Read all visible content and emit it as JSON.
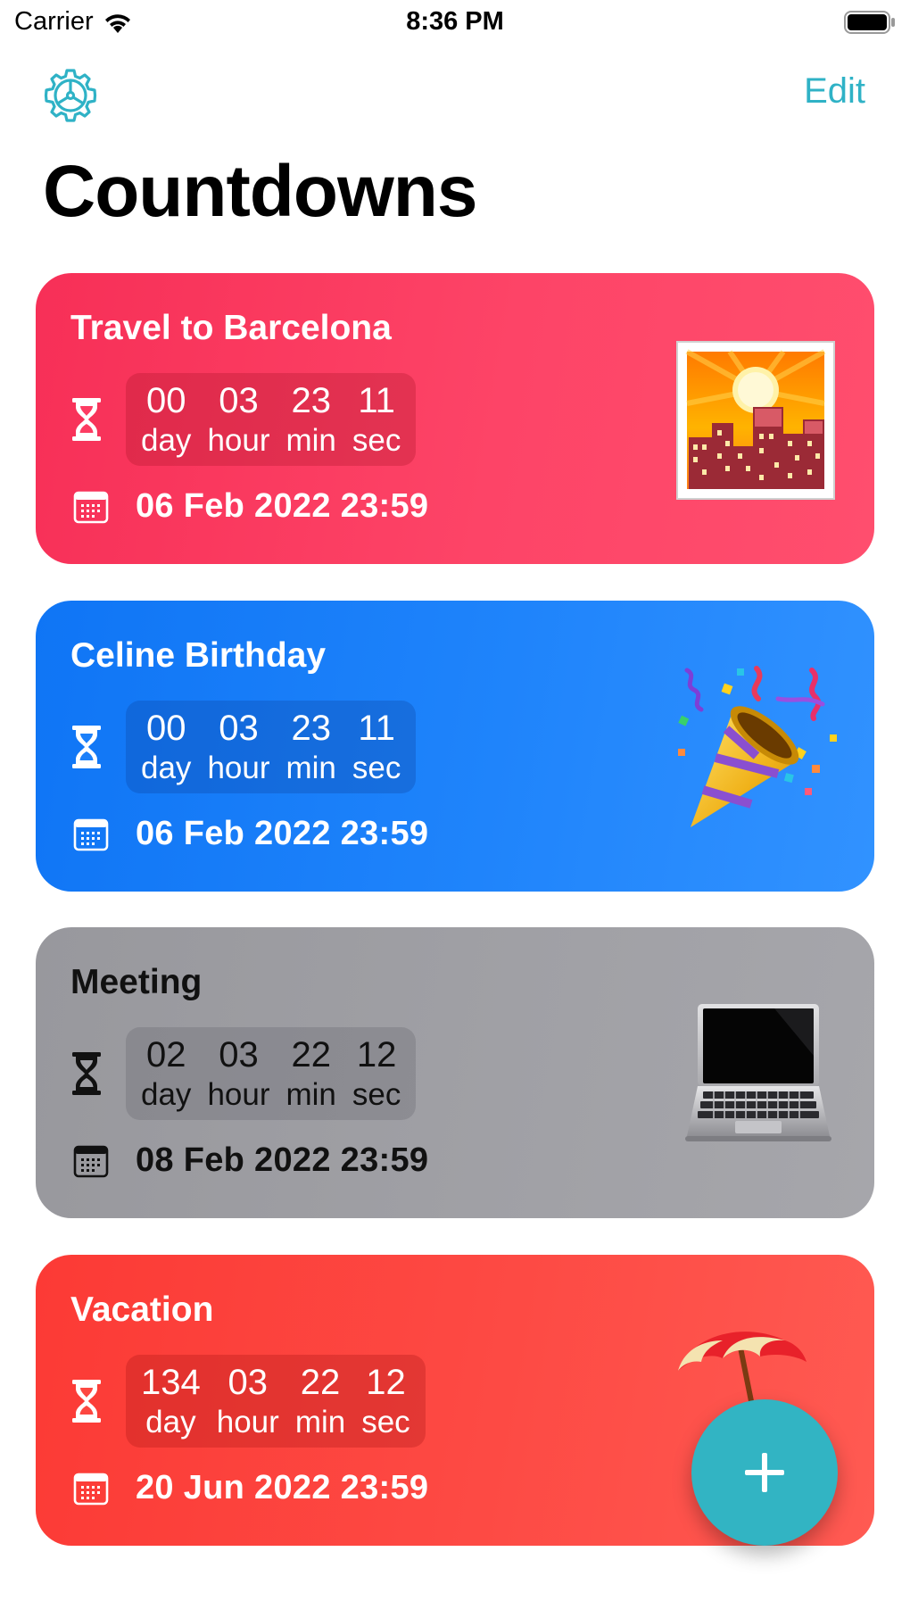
{
  "status_bar": {
    "carrier": "Carrier",
    "time": "8:36 PM"
  },
  "nav": {
    "edit_label": "Edit",
    "settings_icon": "gear-icon",
    "title": "Countdowns"
  },
  "theme": {
    "accent": "#2fb2c6",
    "fab_color": "#32b4c3"
  },
  "countdowns": [
    {
      "title": "Travel to Barcelona",
      "days": "00",
      "hours": "03",
      "minutes": "23",
      "seconds": "11",
      "day_label": "day",
      "hour_label": "hour",
      "min_label": "min",
      "sec_label": "sec",
      "date": "06 Feb 2022 23:59",
      "emoji": "sunset-city-emoji",
      "color": "#fd3c63"
    },
    {
      "title": "Celine Birthday",
      "days": "00",
      "hours": "03",
      "minutes": "23",
      "seconds": "11",
      "day_label": "day",
      "hour_label": "hour",
      "min_label": "min",
      "sec_label": "sec",
      "date": "06 Feb 2022 23:59",
      "emoji": "party-popper-emoji",
      "color": "#1c80fa"
    },
    {
      "title": "Meeting",
      "days": "02",
      "hours": "03",
      "minutes": "22",
      "seconds": "12",
      "day_label": "day",
      "hour_label": "hour",
      "min_label": "min",
      "sec_label": "sec",
      "date": "08 Feb 2022 23:59",
      "emoji": "laptop-emoji",
      "color": "#9e9ea3"
    },
    {
      "title": "Vacation",
      "days": "134",
      "hours": "03",
      "minutes": "22",
      "seconds": "12",
      "day_label": "day",
      "hour_label": "hour",
      "min_label": "min",
      "sec_label": "sec",
      "date": "20 Jun 2022 23:59",
      "emoji": "beach-umbrella-emoji",
      "color": "#fd4741"
    }
  ],
  "fab": {
    "icon": "plus-icon"
  }
}
